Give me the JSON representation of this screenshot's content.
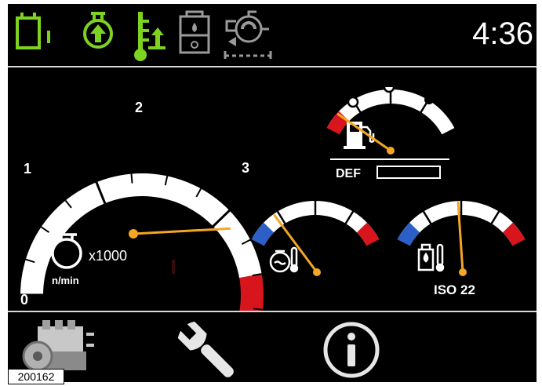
{
  "status_bar": {
    "clock": "4:36",
    "indicators": [
      {
        "icon": "battery-charge-icon",
        "color": "#7ed321",
        "active": true
      },
      {
        "icon": "oil-pressure-icon",
        "color": "#7ed321",
        "active": true
      },
      {
        "icon": "coolant-temp-rising-icon",
        "color": "#7ed321",
        "active": true
      },
      {
        "icon": "fuel-water-separator-icon",
        "color": "#9a9a9a",
        "active": false
      },
      {
        "icon": "turbo-boost-icon",
        "color": "#9a9a9a",
        "active": false
      }
    ]
  },
  "tachometer": {
    "ticks": [
      "0",
      "1",
      "2",
      "3"
    ],
    "unit_scale": "x1000",
    "unit": "n/min",
    "value_x1000": 2.1,
    "redline_start": 2.5,
    "max": 3
  },
  "def_gauge": {
    "label": "DEF",
    "level_fraction": 0.12,
    "zone_marks": [
      "empty",
      "half",
      "full"
    ]
  },
  "coolant_gauge": {
    "level_fraction": 0.22
  },
  "hydraulic_oil_gauge": {
    "label": "ISO 22",
    "level_fraction": 0.48
  },
  "bottom_bar": {
    "buttons": [
      {
        "icon": "engine-icon",
        "name": "engine"
      },
      {
        "icon": "wrench-icon",
        "name": "service"
      },
      {
        "icon": "info-icon",
        "name": "info"
      }
    ]
  },
  "image_id": "200162",
  "colors": {
    "indicator_active": "#7ed321",
    "indicator_inactive": "#9a9a9a",
    "needle": "#f5a623",
    "red_zone": "#d8151d",
    "blue_zone": "#2c5fc7",
    "background": "#000000",
    "divider": "#d8d8d8"
  }
}
